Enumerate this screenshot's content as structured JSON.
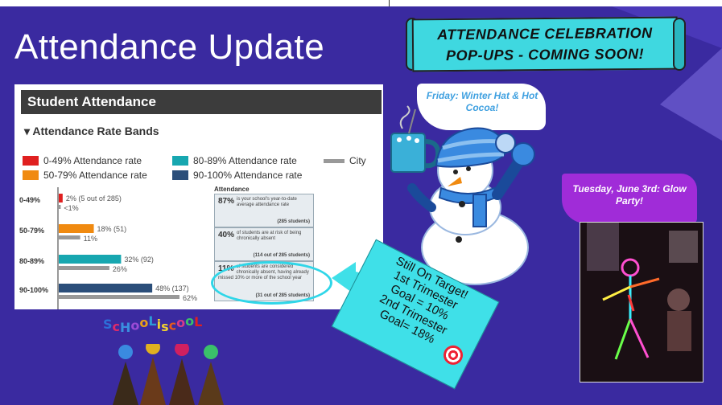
{
  "slide": {
    "title": "Attendance Update",
    "colors": {
      "background": "#3a2aa0",
      "accent": "#3fd8e0"
    }
  },
  "banner": {
    "line1": "ATTENDANCE CELEBRATION",
    "line2": "POP-UPS - COMING SOON!"
  },
  "friday": {
    "text": "Friday: Winter Hat & Hot Cocoa!"
  },
  "tuesday": {
    "text": "Tuesday, June 3rd: Glow Party!"
  },
  "panel": {
    "header": "Student Attendance",
    "section_title": "Attendance Rate Bands",
    "legend": [
      {
        "label": "0-49% Attendance rate",
        "color": "#e02020"
      },
      {
        "label": "50-79% Attendance rate",
        "color": "#f08a10"
      },
      {
        "label": "80-89% Attendance rate",
        "color": "#17a7b0"
      },
      {
        "label": "90-100% Attendance rate",
        "color": "#2b4e7a"
      },
      {
        "label": "City",
        "color": "#999999"
      }
    ],
    "attendance_label": "Attendance",
    "stats": [
      {
        "pct": "87%",
        "desc": "is your school's year-to-date average attendance rate",
        "count": "(285 students)"
      },
      {
        "pct": "40%",
        "desc": "of students are at risk of being chronically absent",
        "count": "(114 out of 285 students)"
      },
      {
        "pct": "11%",
        "desc": "of students are considered chronically absent, having already missed 10% or more of the school year",
        "count": "(31 out of 285 students)"
      }
    ]
  },
  "chart_data": {
    "type": "bar",
    "orientation": "horizontal",
    "categories": [
      "0-49%",
      "50-79%",
      "80-89%",
      "90-100%"
    ],
    "series": [
      {
        "name": "School",
        "values": [
          2,
          18,
          32,
          48
        ],
        "labels": [
          "2% (5 out of 285)",
          "18% (51)",
          "32% (92)",
          "48% (137)"
        ],
        "colors": [
          "#e02020",
          "#f08a10",
          "#17a7b0",
          "#2b4e7a"
        ]
      },
      {
        "name": "City",
        "values": [
          1,
          11,
          26,
          62
        ],
        "labels": [
          "<1%",
          "11%",
          "26%",
          "62%"
        ],
        "color": "#999999"
      }
    ],
    "xlim": [
      0,
      62
    ]
  },
  "note": {
    "lines": [
      "Still On Target!",
      "1st Trimester",
      "Goal = 10%",
      "2nd Trimester",
      "Goal= 18%"
    ],
    "icon": "target-icon"
  },
  "school_cool": {
    "letters": [
      {
        "ch": "S",
        "color": "#2c6fd8"
      },
      {
        "ch": "c",
        "color": "#e02b6a"
      },
      {
        "ch": "H",
        "color": "#3a8fe0"
      },
      {
        "ch": "o",
        "color": "#9b4bd6"
      },
      {
        "ch": "o",
        "color": "#e7a019"
      },
      {
        "ch": "L",
        "color": "#2c9ad8"
      },
      {
        "ch": " ",
        "color": "#fff"
      },
      {
        "ch": "i",
        "color": "#f0d030"
      },
      {
        "ch": "s",
        "color": "#f0d030"
      },
      {
        "ch": " ",
        "color": "#fff"
      },
      {
        "ch": "c",
        "color": "#e85a1a"
      },
      {
        "ch": "o",
        "color": "#d63a8a"
      },
      {
        "ch": "o",
        "color": "#3ac06a"
      },
      {
        "ch": "L",
        "color": "#e02020"
      }
    ]
  }
}
